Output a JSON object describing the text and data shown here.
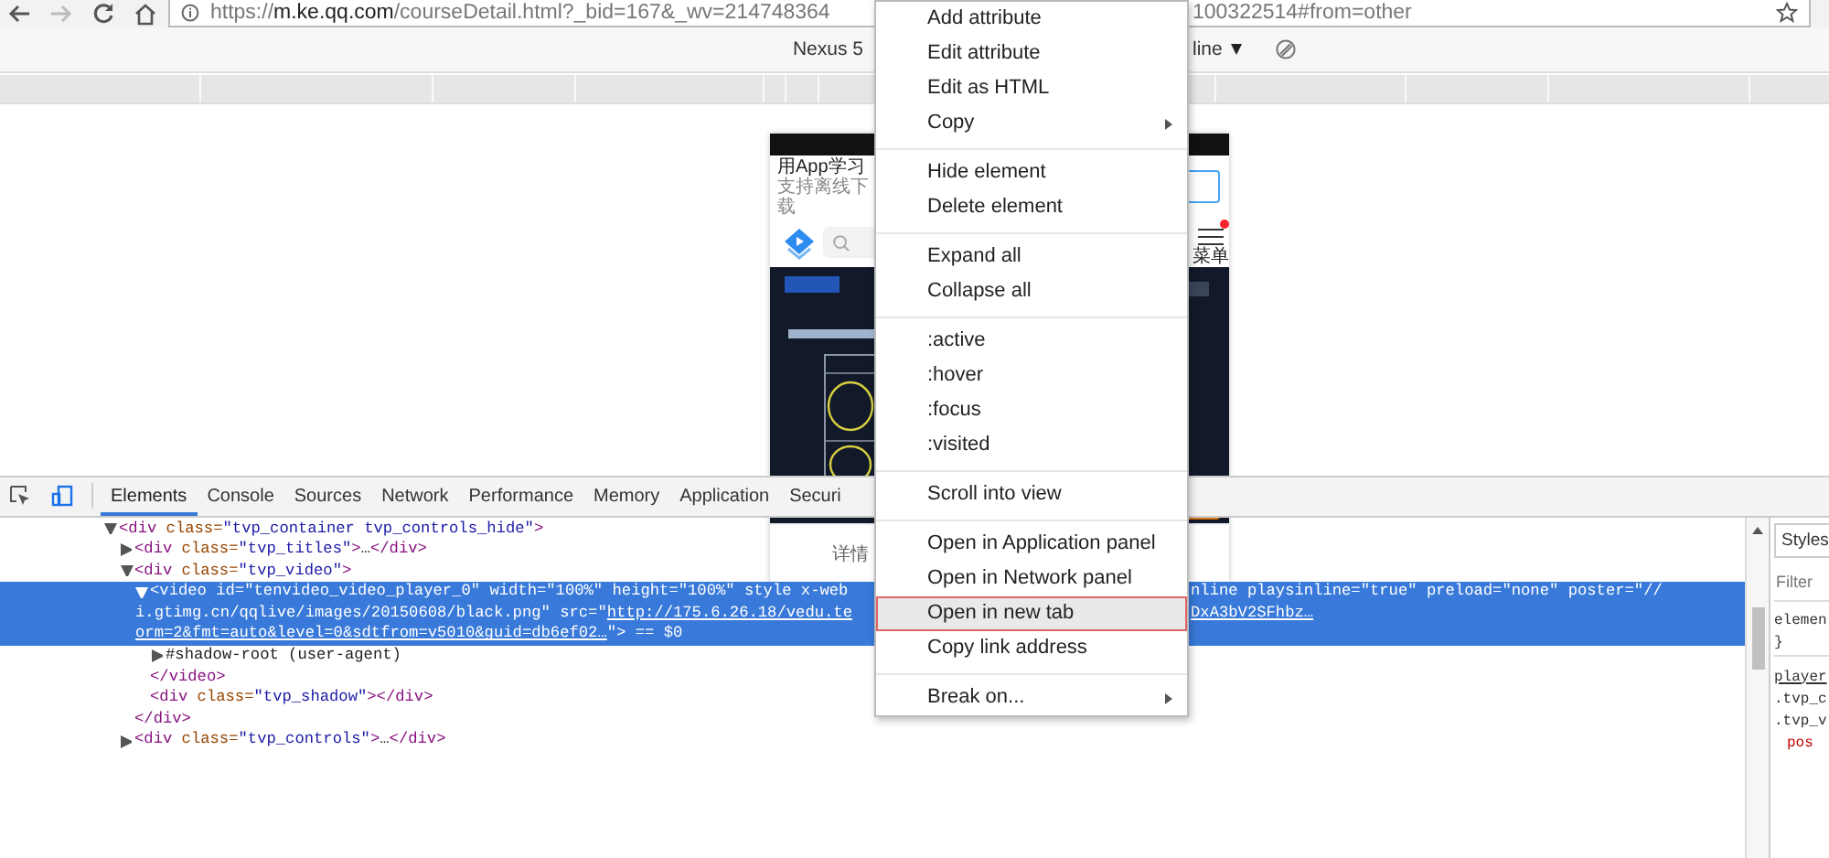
{
  "browser": {
    "url_scheme": "https://",
    "url_host": "m.ke.qq.com",
    "url_path_left": "/courseDetail.html?_bid=167&_wv=214748364",
    "url_path_right": "100322514#from=other",
    "bookmarked": false
  },
  "device_toolbar": {
    "device": "Nexus 5",
    "throttling": "line"
  },
  "phone": {
    "banner_title": "用App学习",
    "banner_subtitle": "支持离线下载",
    "menu_label": "菜单",
    "menu_badge": true,
    "tab": "详情"
  },
  "devtools": {
    "tabs": [
      {
        "label": "Elements",
        "selected": true
      },
      {
        "label": "Console",
        "selected": false
      },
      {
        "label": "Sources",
        "selected": false
      },
      {
        "label": "Network",
        "selected": false
      },
      {
        "label": "Performance",
        "selected": false
      },
      {
        "label": "Memory",
        "selected": false
      },
      {
        "label": "Application",
        "selected": false
      },
      {
        "label": "Securi",
        "selected": false
      }
    ],
    "tree": [
      {
        "selected": false,
        "expanded": true,
        "line": [
          {
            "kind": "tag",
            "text": "<div"
          },
          {
            "kind": "attr",
            "text": " class="
          },
          {
            "kind": "value",
            "text": "\"tvp_container tvp_controls_hide\""
          },
          {
            "kind": "tag",
            "text": ">"
          }
        ],
        "children": [
          {
            "selected": false,
            "expanded": false,
            "line": [
              {
                "kind": "tag",
                "text": "<div"
              },
              {
                "kind": "attr",
                "text": " class="
              },
              {
                "kind": "value",
                "text": "\"tvp_titles\""
              },
              {
                "kind": "tag",
                "text": ">"
              },
              {
                "kind": "text",
                "text": "…"
              },
              {
                "kind": "tag",
                "text": "</div>"
              }
            ]
          },
          {
            "selected": false,
            "expanded": true,
            "line": [
              {
                "kind": "tag",
                "text": "<div"
              },
              {
                "kind": "attr",
                "text": " class="
              },
              {
                "kind": "value",
                "text": "\"tvp_video\""
              },
              {
                "kind": "tag",
                "text": ">"
              }
            ],
            "children": [
              {
                "selected": true,
                "expanded": true,
                "lines": [
                  {
                    "left": [
                      {
                        "kind": "tag",
                        "text": "<video"
                      },
                      {
                        "kind": "attr",
                        "text": " id="
                      },
                      {
                        "kind": "value",
                        "text": "\"tenvideo_video_player_0\""
                      },
                      {
                        "kind": "attr",
                        "text": " width="
                      },
                      {
                        "kind": "value",
                        "text": "\"100%\""
                      },
                      {
                        "kind": "attr",
                        "text": " height="
                      },
                      {
                        "kind": "value",
                        "text": "\"100%\""
                      },
                      {
                        "kind": "attr",
                        "text": " style x-web"
                      }
                    ],
                    "right": [
                      {
                        "kind": "attr",
                        "text": "nline playsinline="
                      },
                      {
                        "kind": "value",
                        "text": "\"true\""
                      },
                      {
                        "kind": "attr",
                        "text": " preload="
                      },
                      {
                        "kind": "value",
                        "text": "\"none\""
                      },
                      {
                        "kind": "attr",
                        "text": " poster="
                      },
                      {
                        "kind": "value",
                        "text": "\"//"
                      }
                    ]
                  },
                  {
                    "left": [
                      {
                        "kind": "value",
                        "text": "i.gtimg.cn/qqlive/images/20150608/black.png\""
                      },
                      {
                        "kind": "attr",
                        "text": " src="
                      },
                      {
                        "kind": "value",
                        "text": "\""
                      },
                      {
                        "kind": "link",
                        "text": "http://175.6.26.18/vedu.te"
                      }
                    ],
                    "right": [
                      {
                        "kind": "link",
                        "text": "DxA3bV2SFhbz…"
                      }
                    ]
                  },
                  {
                    "left": [
                      {
                        "kind": "link",
                        "text": "orm=2&fmt=auto&level=0&sdtfrom=v5010&guid=db6ef02…"
                      },
                      {
                        "kind": "value",
                        "text": "\""
                      },
                      {
                        "kind": "tag",
                        "text": ">"
                      },
                      {
                        "kind": "muted",
                        "text": " == $0"
                      }
                    ]
                  }
                ],
                "children": [
                  {
                    "selected": false,
                    "expanded": false,
                    "line": [
                      {
                        "kind": "text",
                        "text": "#shadow-root (user-agent)"
                      }
                    ]
                  }
                ],
                "closing": [
                  {
                    "kind": "tag",
                    "text": "</video>"
                  }
                ]
              },
              {
                "selected": false,
                "line": [
                  {
                    "kind": "tag",
                    "text": "<div"
                  },
                  {
                    "kind": "attr",
                    "text": " class="
                  },
                  {
                    "kind": "value",
                    "text": "\"tvp_shadow\""
                  },
                  {
                    "kind": "tag",
                    "text": "></div>"
                  }
                ]
              }
            ],
            "closing": [
              {
                "kind": "tag",
                "text": "</div>"
              }
            ]
          },
          {
            "selected": false,
            "expanded": false,
            "line": [
              {
                "kind": "tag",
                "text": "<div"
              },
              {
                "kind": "attr",
                "text": " class="
              },
              {
                "kind": "value",
                "text": "\"tvp_controls\""
              },
              {
                "kind": "tag",
                "text": ">"
              },
              {
                "kind": "text",
                "text": "…"
              },
              {
                "kind": "tag",
                "text": "</div>"
              }
            ]
          }
        ]
      }
    ],
    "styles": {
      "tab": "Styles",
      "filter_placeholder": "Filter",
      "lines": [
        {
          "kind": "selector",
          "text": "elemen"
        },
        {
          "kind": "brace",
          "text": "}"
        },
        {
          "kind": "source",
          "text": "player"
        },
        {
          "kind": "selector",
          "text": ".tvp_c"
        },
        {
          "kind": "selector",
          "text": ".tvp_v"
        },
        {
          "kind": "property",
          "text": "pos"
        }
      ]
    }
  },
  "context_menu": {
    "items": [
      {
        "kind": "item",
        "label": "Add attribute",
        "submenu": false,
        "selected": false
      },
      {
        "kind": "item",
        "label": "Edit attribute",
        "submenu": false,
        "selected": false
      },
      {
        "kind": "item",
        "label": "Edit as HTML",
        "submenu": false,
        "selected": false
      },
      {
        "kind": "item",
        "label": "Copy",
        "submenu": true,
        "selected": false
      },
      {
        "kind": "separator"
      },
      {
        "kind": "item",
        "label": "Hide element",
        "submenu": false,
        "selected": false
      },
      {
        "kind": "item",
        "label": "Delete element",
        "submenu": false,
        "selected": false
      },
      {
        "kind": "separator"
      },
      {
        "kind": "item",
        "label": "Expand all",
        "submenu": false,
        "selected": false
      },
      {
        "kind": "item",
        "label": "Collapse all",
        "submenu": false,
        "selected": false
      },
      {
        "kind": "separator"
      },
      {
        "kind": "item",
        "label": ":active",
        "submenu": false,
        "selected": false
      },
      {
        "kind": "item",
        "label": ":hover",
        "submenu": false,
        "selected": false
      },
      {
        "kind": "item",
        "label": ":focus",
        "submenu": false,
        "selected": false
      },
      {
        "kind": "item",
        "label": ":visited",
        "submenu": false,
        "selected": false
      },
      {
        "kind": "separator"
      },
      {
        "kind": "item",
        "label": "Scroll into view",
        "submenu": false,
        "selected": false
      },
      {
        "kind": "separator"
      },
      {
        "kind": "item",
        "label": "Open in Application panel",
        "submenu": false,
        "selected": false
      },
      {
        "kind": "item",
        "label": "Open in Network panel",
        "submenu": false,
        "selected": false
      },
      {
        "kind": "item",
        "label": "Open in new tab",
        "submenu": false,
        "selected": true
      },
      {
        "kind": "item",
        "label": "Copy link address",
        "submenu": false,
        "selected": false
      },
      {
        "kind": "separator"
      },
      {
        "kind": "item",
        "label": "Break on...",
        "submenu": true,
        "selected": false
      }
    ]
  }
}
